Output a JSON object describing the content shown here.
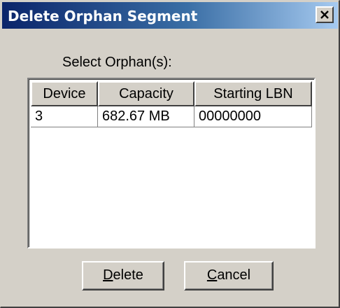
{
  "window": {
    "title": "Delete Orphan Segment"
  },
  "prompt": "Select Orphan(s):",
  "table": {
    "columns": [
      "Device",
      "Capacity",
      "Starting LBN"
    ],
    "rows": [
      [
        "3",
        "682.67 MB",
        "00000000"
      ]
    ]
  },
  "buttons": {
    "delete": {
      "mnemonic": "D",
      "rest": "elete"
    },
    "cancel": {
      "mnemonic": "C",
      "rest": "ancel"
    }
  },
  "colors": {
    "dialog_face": "#d4d0c8",
    "title_gradient_start": "#0a246a",
    "title_gradient_end": "#a6caf0",
    "title_text": "#ffffff"
  },
  "icons": {
    "close": "close-icon"
  }
}
